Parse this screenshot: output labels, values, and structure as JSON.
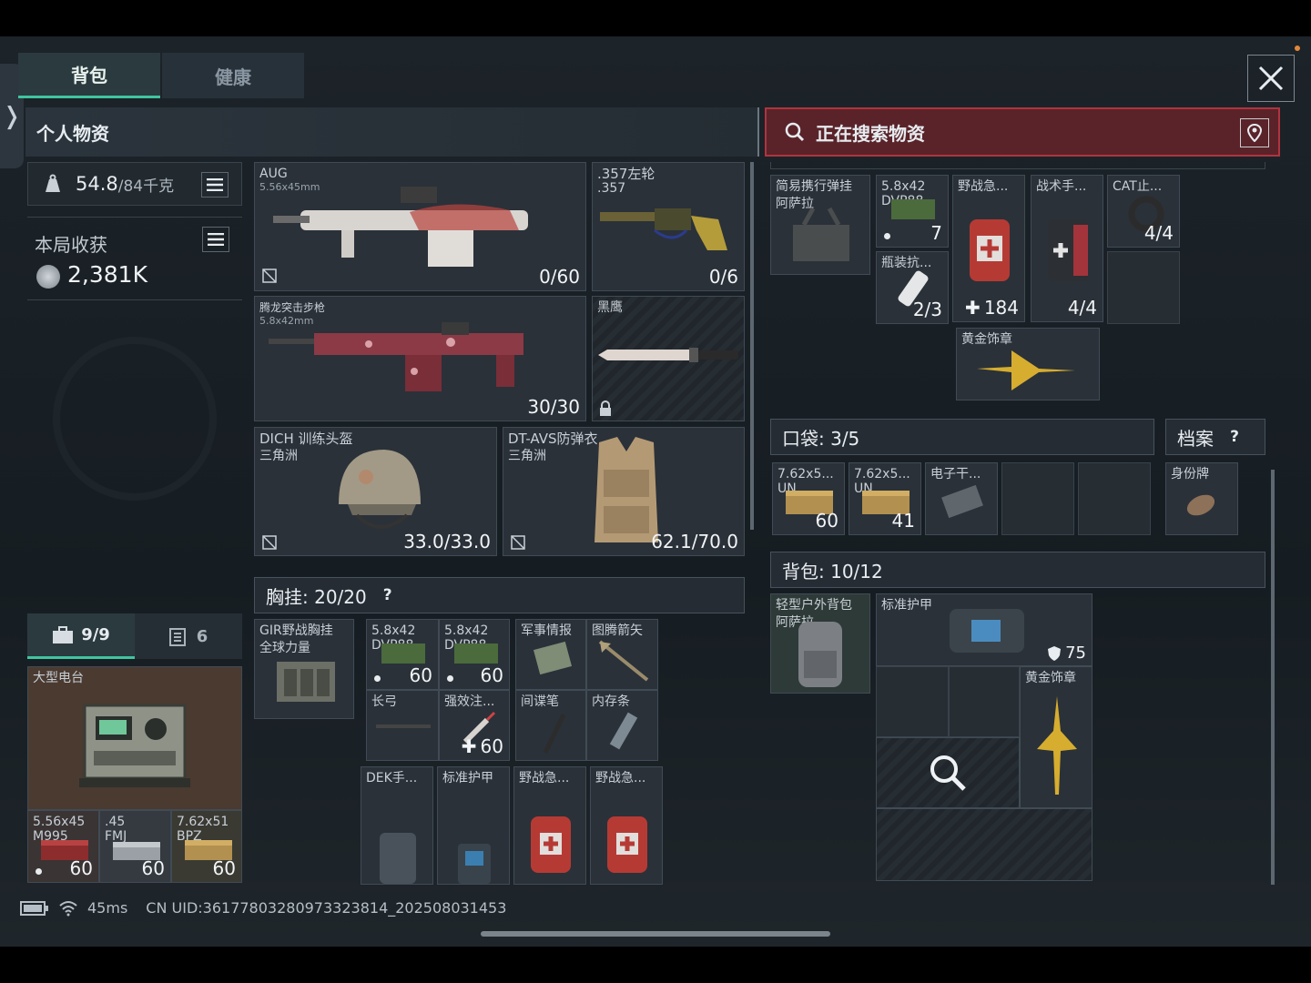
{
  "tabs": [
    {
      "label": "背包"
    },
    {
      "label": "健康"
    }
  ],
  "personal": {
    "title": "个人物资",
    "weight": "54.8",
    "weight_max": "/84千克",
    "earnings_label": "本局收获",
    "earnings_value": "2,381K"
  },
  "search": {
    "title": "正在搜索物资"
  },
  "weapons": {
    "primary": {
      "name": "AUG",
      "caliber": "5.56x45mm",
      "ammo": "0/60"
    },
    "pistol": {
      "name": ".357左轮",
      "caliber": ".357",
      "ammo": "0/6"
    },
    "secondary": {
      "name": "腾龙突击步枪",
      "caliber": "5.8x42mm",
      "ammo": "30/30"
    },
    "melee": {
      "name": "黑鹰"
    },
    "helmet": {
      "name": "DICH 训练头盔",
      "origin": "三角洲",
      "durability": "33.0/33.0"
    },
    "armor": {
      "name": "DT-AVS防弹衣",
      "origin": "三角洲",
      "durability": "62.1/70.0"
    }
  },
  "chest_rig": {
    "label": "胸挂: 20/20",
    "help": "?",
    "rig_item": {
      "name": "GIR野战胸挂",
      "sub": "全球力量"
    },
    "items": [
      {
        "name": "5.8x42",
        "sub": "DVP88",
        "count": "60"
      },
      {
        "name": "5.8x42",
        "sub": "DVP88",
        "count": "60"
      },
      {
        "name": "军事情报",
        "count": ""
      },
      {
        "name": "图腾箭矢",
        "count": ""
      },
      {
        "name": "长弓",
        "count": ""
      },
      {
        "name": "强效注...",
        "count": "60"
      },
      {
        "name": "间谍笔",
        "count": ""
      },
      {
        "name": "内存条",
        "count": ""
      },
      {
        "name": "DEK手...",
        "count": ""
      },
      {
        "name": "标准护甲",
        "count": ""
      },
      {
        "name": "野战急...",
        "count": ""
      },
      {
        "name": "野战急...",
        "count": ""
      }
    ]
  },
  "safe_box": {
    "tab1": "9/9",
    "tab2": "6",
    "main_item": "大型电台",
    "ammo": [
      {
        "name": "5.56x45",
        "sub": "M995",
        "count": "60"
      },
      {
        "name": ".45",
        "sub": "FMJ",
        "count": "60"
      },
      {
        "name": "7.62x51",
        "sub": "BPZ",
        "count": "60"
      }
    ]
  },
  "loot": {
    "items": [
      {
        "name": "简易携行弹挂",
        "sub": "阿萨拉"
      },
      {
        "name": "5.8x42",
        "sub": "DVP88",
        "count": "7"
      },
      {
        "name": "野战急...",
        "count": "184"
      },
      {
        "name": "战术手...",
        "count": "4/4"
      },
      {
        "name": "CAT止...",
        "count": "4/4"
      },
      {
        "name": "瓶装抗...",
        "count": "2/3"
      },
      {
        "name": "黄金饰章"
      }
    ]
  },
  "pocket": {
    "label": "口袋: 3/5",
    "items": [
      {
        "name": "7.62x5...",
        "sub": "UN",
        "count": "60"
      },
      {
        "name": "7.62x5...",
        "sub": "UN",
        "count": "41"
      },
      {
        "name": "电子干..."
      }
    ]
  },
  "dossier": {
    "label": "档案",
    "help": "?",
    "item": "身份牌"
  },
  "backpack": {
    "label": "背包: 10/12",
    "bag": {
      "name": "轻型户外背包",
      "sub": "阿萨拉"
    },
    "items": [
      {
        "name": "标准护甲",
        "armor": "75"
      },
      {
        "name": "黄金饰章"
      }
    ]
  },
  "status": {
    "ping": "45ms",
    "uid": "CN UID:3617780328097332​3814_202508031453"
  },
  "colors": {
    "accent": "#3fc5a0",
    "search_red": "#8c1f28",
    "bg": "#1c2329"
  }
}
